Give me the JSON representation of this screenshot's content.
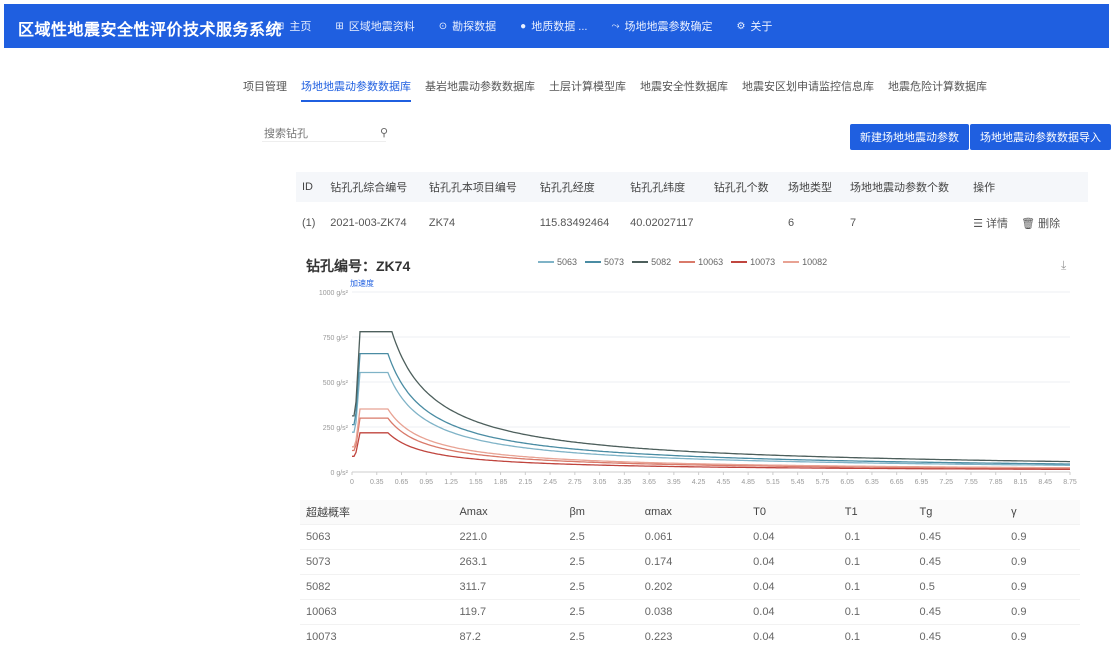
{
  "app": {
    "title": "区域性地震安全性评价技术服务系统"
  },
  "nav": [
    {
      "icon": "home-icon",
      "glyph": "⊞",
      "label": "主页"
    },
    {
      "icon": "grid-icon",
      "glyph": "⊞",
      "label": "区域地震资料"
    },
    {
      "icon": "target-icon",
      "glyph": "⊙",
      "label": "勘探数据"
    },
    {
      "icon": "dot-icon",
      "glyph": "●",
      "label": "地质数据 ..."
    },
    {
      "icon": "trend-icon",
      "glyph": "⤳",
      "label": "场地地震参数确定"
    },
    {
      "icon": "settings-icon",
      "glyph": "⚙",
      "label": "关于"
    }
  ],
  "tabs": [
    "项目管理",
    "场地地震动参数数据库",
    "基岩地震动参数数据库",
    "土层计算模型库",
    "地震安全性数据库",
    "地震安区划申请监控信息库",
    "地震危险计算数据库"
  ],
  "active_tab": 1,
  "search": {
    "placeholder": "搜索钻孔"
  },
  "buttons": {
    "btn1": "新建场地地震动参数",
    "btn2": "场地地震动参数数据导入"
  },
  "table1": {
    "headers": [
      "ID",
      "钻孔孔综合编号",
      "钻孔孔本项目编号",
      "钻孔孔经度",
      "钻孔孔纬度",
      "钻孔孔个数",
      "场地类型",
      "场地地震动参数个数",
      "操作"
    ],
    "rows": [
      {
        "id": "(1)",
        "code": "2021-003-ZK74",
        "short": "ZK74",
        "lon": "115.83492464",
        "lat": "40.02027117",
        "count": "",
        "type": "6",
        "params": "7",
        "op_detail": "详情",
        "op_delete": "删除"
      }
    ]
  },
  "chart": {
    "title_label": "钻孔编号：ZK74",
    "y_caption": "加速度",
    "legend_heading": ""
  },
  "chart_data": {
    "type": "line",
    "ylabel": "加速度",
    "ylim": [
      0,
      1000
    ],
    "yticks": [
      "0 g/s²",
      "250 g/s²",
      "500 g/s²",
      "750 g/s²",
      "1000 g/s²"
    ],
    "x_tick_labels": [
      "0",
      "0.35",
      "0.65",
      "0.95",
      "1.25",
      "1.55",
      "1.85",
      "2.15",
      "2.45",
      "2.75",
      "3.05",
      "3.35",
      "3.65",
      "3.95",
      "4.25",
      "4.55",
      "4.85",
      "5.15",
      "5.45",
      "5.75",
      "6.05",
      "6.35",
      "6.65",
      "6.95",
      "7.25",
      "7.55",
      "7.85",
      "8.15",
      "8.45",
      "8.75"
    ],
    "xlim": [
      0,
      9.0
    ],
    "series": [
      {
        "name": "5063",
        "color": "#7fb3c7",
        "Amax": 221.0,
        "Bm": 2.5,
        "T0": 0.04,
        "T1": 0.1,
        "Tg": 0.45,
        "gamma": 0.9
      },
      {
        "name": "5073",
        "color": "#4a8ca3",
        "Amax": 263.1,
        "Bm": 2.5,
        "T0": 0.04,
        "T1": 0.1,
        "Tg": 0.45,
        "gamma": 0.9
      },
      {
        "name": "5082",
        "color": "#4d5f5c",
        "Amax": 311.7,
        "Bm": 2.5,
        "T0": 0.04,
        "T1": 0.1,
        "Tg": 0.5,
        "gamma": 0.9
      },
      {
        "name": "10063",
        "color": "#d97a6a",
        "Amax": 119.7,
        "Bm": 2.5,
        "T0": 0.04,
        "T1": 0.1,
        "Tg": 0.45,
        "gamma": 0.9
      },
      {
        "name": "10073",
        "color": "#c0453e",
        "Amax": 87.2,
        "Bm": 2.5,
        "T0": 0.04,
        "T1": 0.1,
        "Tg": 0.45,
        "gamma": 0.9
      },
      {
        "name": "10082",
        "color": "#e8a293",
        "Amax": 140.0,
        "Bm": 2.5,
        "T0": 0.04,
        "T1": 0.1,
        "Tg": 0.45,
        "gamma": 0.9
      }
    ]
  },
  "table2": {
    "headers": [
      "超越概率",
      "Amax",
      "βm",
      "αmax",
      "T0",
      "T1",
      "Tg",
      "γ"
    ],
    "rows": [
      [
        "5063",
        "221.0",
        "2.5",
        "0.061",
        "0.04",
        "0.1",
        "0.45",
        "0.9"
      ],
      [
        "5073",
        "263.1",
        "2.5",
        "0.174",
        "0.04",
        "0.1",
        "0.45",
        "0.9"
      ],
      [
        "5082",
        "311.7",
        "2.5",
        "0.202",
        "0.04",
        "0.1",
        "0.5",
        "0.9"
      ],
      [
        "10063",
        "119.7",
        "2.5",
        "0.038",
        "0.04",
        "0.1",
        "0.45",
        "0.9"
      ],
      [
        "10073",
        "87.2",
        "2.5",
        "0.223",
        "0.04",
        "0.1",
        "0.45",
        "0.9"
      ]
    ]
  }
}
